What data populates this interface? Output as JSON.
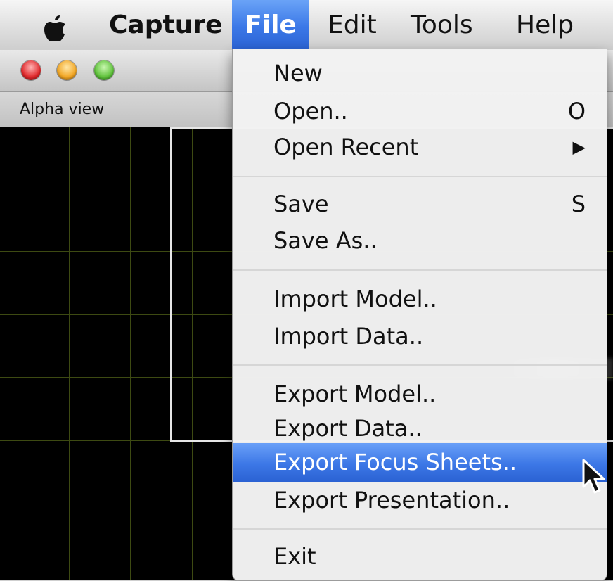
{
  "menubar": {
    "app_name": "Capture",
    "items": [
      {
        "label": "File",
        "active": true
      },
      {
        "label": "Edit"
      },
      {
        "label": "Tools"
      },
      {
        "label": "Help"
      }
    ]
  },
  "window": {
    "view_label": "Alpha view"
  },
  "file_menu": {
    "items": [
      {
        "label": "New"
      },
      {
        "label": "Open..",
        "shortcut": "O"
      },
      {
        "label": "Open Recent",
        "submenu": true
      },
      {
        "label": "Save",
        "shortcut": "S"
      },
      {
        "label": "Save As.."
      },
      {
        "label": "Import Model.."
      },
      {
        "label": "Import Data.."
      },
      {
        "label": "Export Model.."
      },
      {
        "label": "Export Data.."
      },
      {
        "label": "Export Focus Sheets..",
        "highlighted": true
      },
      {
        "label": "Export Presentation.."
      },
      {
        "label": "Exit"
      }
    ],
    "submenu_glyph": "▶"
  },
  "colors": {
    "highlight": "#3c77e6",
    "canvas": "#000000",
    "grid": "#3d4a12"
  },
  "icons": {
    "apple": "apple-logo-icon",
    "cursor": "mouse-pointer-icon"
  }
}
